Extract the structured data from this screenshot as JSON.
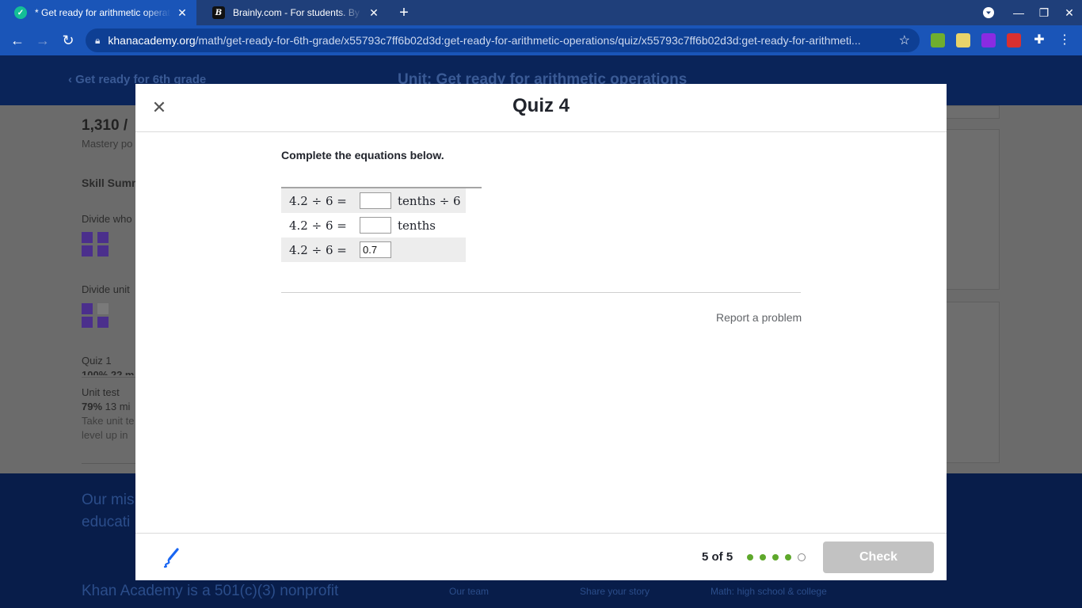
{
  "browser": {
    "tabs": [
      {
        "title": "* Get ready for arithmetic operat",
        "active": true,
        "favicon": "khan-academy-icon"
      },
      {
        "title": "Brainly.com - For students. By st",
        "active": false,
        "favicon": "brainly-icon",
        "favicon_letter": "B"
      }
    ],
    "new_tab_symbol": "+",
    "url_domain": "khanacademy.org",
    "url_path": "/math/get-ready-for-6th-grade/x55793c7ff6b02d3d:get-ready-for-arithmetic-operations/quiz/x55793c7ff6b02d3d:get-ready-for-arithmeti..."
  },
  "page": {
    "back_link": "Get ready for 6th grade",
    "unit_title": "Unit: Get ready for arithmetic operations",
    "mastery_points": "1,310 /",
    "mastery_label": "Mastery po",
    "skill_summary": "Skill Summ",
    "skill_1": "Divide who",
    "skill_2": "Divide unit",
    "quiz_1": "Quiz 1",
    "quiz_1_score": "100% 22 m",
    "unit_test": "Unit test",
    "unit_test_pct": "79%",
    "unit_test_time": "13 mi",
    "unit_test_desc_1": "Take unit te",
    "unit_test_desc_2": "level up in",
    "footer_mission_1": "Our mis",
    "footer_mission_2": "educati",
    "footer_nonprofit": "Khan Academy is a 501(c)(3) nonprofit",
    "footer_links": [
      "Our team",
      "Share your story",
      "Math: high school & college"
    ]
  },
  "modal": {
    "title": "Quiz 4",
    "prompt": "Complete the equations below.",
    "equations": [
      {
        "lhs": "4.2 ÷ 6 =",
        "input": "",
        "rhs": "tenths ÷ 6"
      },
      {
        "lhs": "4.2 ÷ 6 =",
        "input": "",
        "rhs": "tenths"
      },
      {
        "lhs": "4.2 ÷ 6 =",
        "input": "0.7",
        "rhs": ""
      }
    ],
    "report_link": "Report a problem",
    "progress_text": "5 of 5",
    "progress_total": 5,
    "progress_completed": 4,
    "check_label": "Check"
  },
  "colors": {
    "chrome_tab_bg": "#1f3f7a",
    "chrome_toolbar_bg": "#1a55b8",
    "progress_done": "#5ea82b",
    "check_disabled": "#c2c2c2"
  }
}
